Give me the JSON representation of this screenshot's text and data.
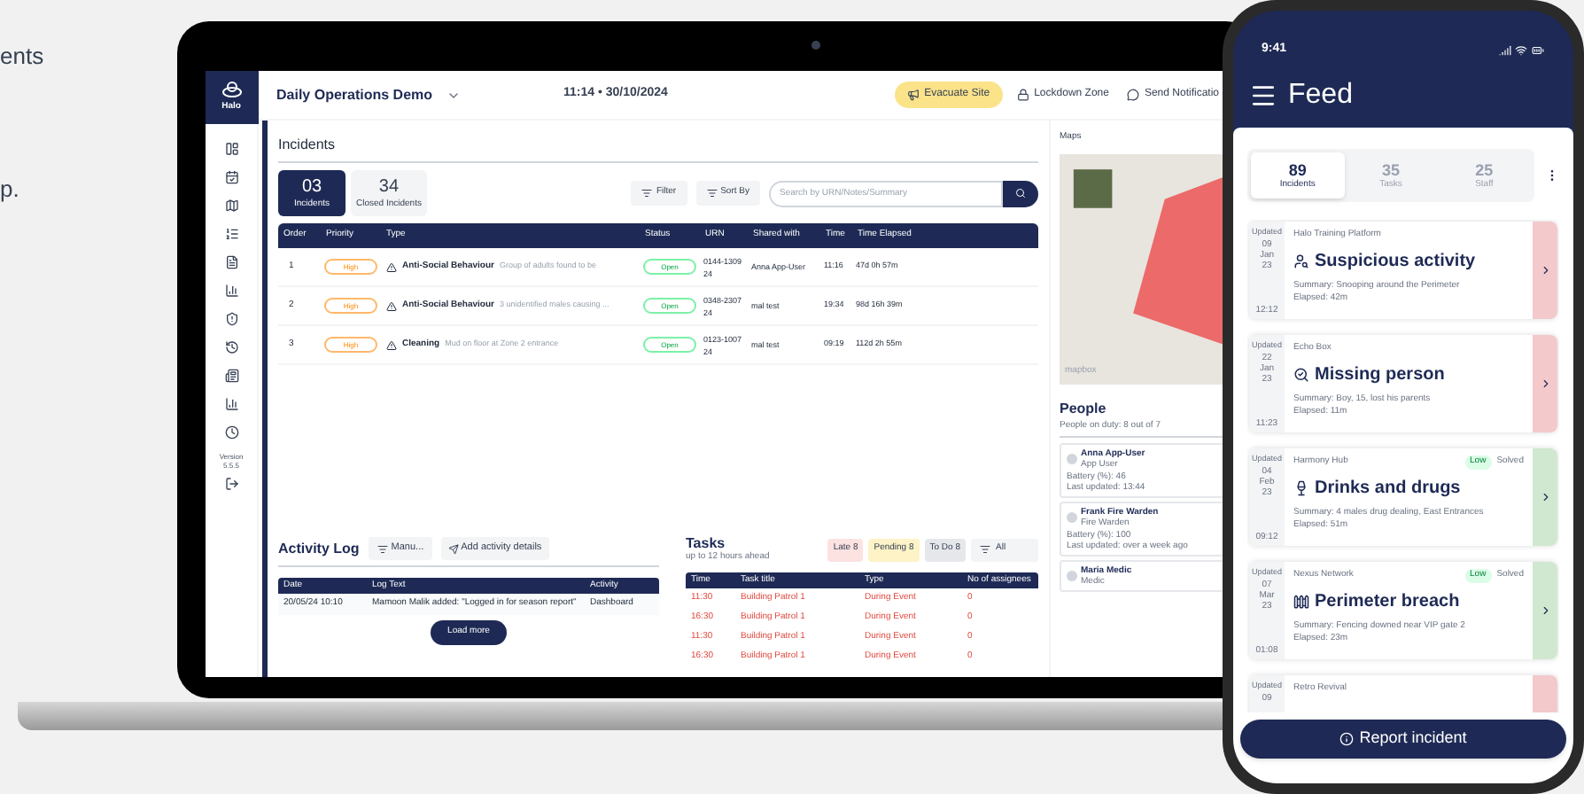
{
  "background_text": [
    "ents",
    "p."
  ],
  "laptop": {
    "logo": "Halo",
    "sidebar": {
      "version_label": "Version",
      "version": "5.5.5"
    },
    "header": {
      "title": "Daily Operations Demo",
      "datetime": "11:14 • 30/10/2024",
      "actions": [
        {
          "label": "Evacuate Site",
          "kind": "alert"
        },
        {
          "label": "Lockdown Zone",
          "kind": "lock"
        },
        {
          "label": "Send Notificatio",
          "kind": "message"
        }
      ]
    },
    "incidents": {
      "title": "Incidents",
      "tabs": [
        {
          "count": "03",
          "label": "Incidents",
          "selected": true
        },
        {
          "count": "34",
          "label": "Closed Incidents",
          "selected": false
        }
      ],
      "filter": "Filter",
      "sort": "Sort By",
      "search": {
        "placeholder": "Search by URN/Notes/Summary"
      },
      "table": {
        "columns": [
          "Order",
          "Priority",
          "Type",
          "Status",
          "URN",
          "Shared with",
          "Time",
          "Time Elapsed"
        ],
        "rows": [
          {
            "order": "1",
            "priority": "High",
            "type": "Anti-Social Behaviour",
            "note": "Group of adults found to be",
            "status": "Open",
            "urn": "0144-130924",
            "shared": "Anna App-User",
            "time": "11:16",
            "elapsed": "47d 0h 57m"
          },
          {
            "order": "2",
            "priority": "High",
            "type": "Anti-Social Behaviour",
            "note": "3 unidentified males causing ...",
            "status": "Open",
            "urn": "0348-230724",
            "shared": "mal test",
            "time": "19:34",
            "elapsed": "98d 16h 39m"
          },
          {
            "order": "3",
            "priority": "High",
            "type": "Cleaning",
            "note": "Mud on floor at Zone 2 entrance",
            "status": "Open",
            "urn": "0123-100724",
            "shared": "mal test",
            "time": "09:19",
            "elapsed": "112d 2h 55m"
          }
        ]
      }
    },
    "activity_log": {
      "title": "Activity Log",
      "filter": "Manu...",
      "add": "Add activity details",
      "columns": [
        "Date",
        "Log Text",
        "Activity"
      ],
      "rows": [
        {
          "date": "20/05/24 10:10",
          "text": "Mamoon Malik added: \"Logged in for season report\"",
          "activity": "Dashboard"
        }
      ],
      "load_more": "Load more"
    },
    "tasks": {
      "title": "Tasks",
      "subtitle": "up to 12 hours ahead",
      "badges": [
        {
          "label": "Late 8",
          "color": "#fde2e2"
        },
        {
          "label": "Pending 8",
          "color": "#fdf3c7"
        },
        {
          "label": "To Do 8",
          "color": "#e5e7eb"
        }
      ],
      "filter": "All",
      "columns": [
        "Time",
        "Task title",
        "Type",
        "No of assignees"
      ],
      "rows": [
        {
          "time": "11:30",
          "title": "Building Patrol 1",
          "type": "During Event",
          "assignees": "0"
        },
        {
          "time": "16:30",
          "title": "Building Patrol 1",
          "type": "During Event",
          "assignees": "0"
        },
        {
          "time": "11:30",
          "title": "Building Patrol 1",
          "type": "During Event",
          "assignees": "0"
        },
        {
          "time": "16:30",
          "title": "Building Patrol 1",
          "type": "During Event",
          "assignees": "0"
        }
      ]
    },
    "maps": {
      "title": "Maps",
      "attribution": "mapbox"
    },
    "people": {
      "title": "People",
      "subtitle": "People on duty: 8 out of 7",
      "items": [
        {
          "name": "Anna App-User",
          "role": "App User",
          "battery": "Battery (%): 46",
          "updated": "Last updated: 13:44"
        },
        {
          "name": "Frank Fire Warden",
          "role": "Fire Warden",
          "battery": "Battery (%): 100",
          "updated": "Last updated: over a week ago"
        },
        {
          "name": "Maria Medic",
          "role": "Medic"
        }
      ]
    }
  },
  "phone": {
    "time": "9:41",
    "title": "Feed",
    "tabs": [
      {
        "count": "89",
        "label": "Incidents",
        "selected": true
      },
      {
        "count": "35",
        "label": "Tasks",
        "selected": false
      },
      {
        "count": "25",
        "label": "Staff",
        "selected": false
      }
    ],
    "cards": [
      {
        "updated": "Updated",
        "day": "09",
        "month": "Jan",
        "year": "23",
        "time": "12:12",
        "source": "Halo Training Platform",
        "title": "Suspicious activity",
        "summary": "Summary: Snooping around the Perimeter",
        "elapsed": "Elapsed: 42m",
        "color": "#f3c9cc"
      },
      {
        "updated": "Updated",
        "day": "22",
        "month": "Jan",
        "year": "23",
        "time": "11:23",
        "source": "Echo Box",
        "title": "Missing person",
        "summary": "Summary: Boy, 15, lost his parents",
        "elapsed": "Elapsed: 11m",
        "color": "#f3c9cc"
      },
      {
        "updated": "Updated",
        "day": "04",
        "month": "Feb",
        "year": "23",
        "time": "09:12",
        "source": "Harmony Hub",
        "priority": "Low",
        "state": "Solved",
        "title": "Drinks and drugs",
        "summary": "Summary: 4 males drug dealing, East Entrances",
        "elapsed": "Elapsed: 51m",
        "color": "#cfe8cf"
      },
      {
        "updated": "Updated",
        "day": "07",
        "month": "Mar",
        "year": "23",
        "time": "01:08",
        "source": "Nexus Network",
        "priority": "Low",
        "state": "Solved",
        "title": "Perimeter breach",
        "summary": "Summary: Fencing downed near VIP gate 2",
        "elapsed": "Elapsed: 23m",
        "color": "#cfe8cf"
      },
      {
        "updated": "Updated",
        "day": "09",
        "source": "Retro Revival",
        "color": "#f3c9cc"
      }
    ],
    "report": "Report incident"
  }
}
